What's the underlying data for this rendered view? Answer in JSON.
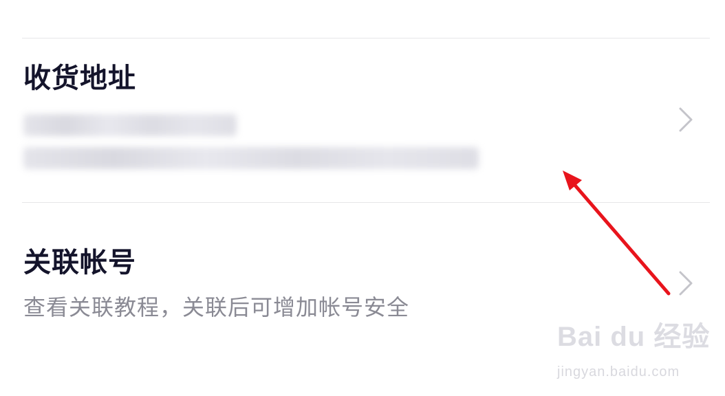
{
  "shipping": {
    "title": "收货地址"
  },
  "linked_account": {
    "title": "关联帐号",
    "subtitle": "查看关联教程，关联后可增加帐号安全"
  },
  "watermark": {
    "logo": "Bai du 经验",
    "url": "jingyan.baidu.com"
  },
  "colors": {
    "title": "#14142b",
    "subtitle": "#8a8a94",
    "divider": "#e6e6e8",
    "chevron": "#c4c4ca",
    "annotation_arrow": "#e8141c"
  },
  "icons": {
    "shipping_chevron": "chevron-right-icon",
    "linked_chevron": "chevron-right-icon"
  }
}
